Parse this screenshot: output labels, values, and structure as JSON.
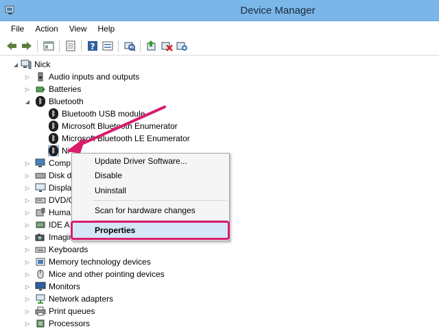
{
  "window": {
    "title": "Device Manager"
  },
  "menu": [
    "File",
    "Action",
    "View",
    "Help"
  ],
  "toolbar": {
    "buttons": [
      "back-icon",
      "forward-icon",
      "properties-pane-icon",
      "show-hide-console-tree-icon",
      "help-icon",
      "view-icon",
      "scan-icon",
      "update-driver-icon",
      "uninstall-icon",
      "add-hardware-icon"
    ]
  },
  "tree": {
    "root": "Nick",
    "items": [
      {
        "label": "Audio inputs and outputs",
        "icon": "speaker-icon"
      },
      {
        "label": "Batteries",
        "icon": "battery-icon"
      },
      {
        "label": "Bluetooth",
        "icon": "bluetooth-icon",
        "expanded": true
      },
      {
        "label": "Bluetooth USB module",
        "icon": "bluetooth-icon",
        "child": true
      },
      {
        "label": "Microsoft Bluetooth Enumerator",
        "icon": "bluetooth-icon",
        "child": true
      },
      {
        "label": "Microsoft Bluetooth LE Enumerator",
        "icon": "bluetooth-icon",
        "child": true
      },
      {
        "label": "Ni",
        "icon": "bluetooth-icon",
        "child": true,
        "selected": true
      },
      {
        "label": "Comp",
        "icon": "computer-icon"
      },
      {
        "label": "Disk d",
        "icon": "disk-icon"
      },
      {
        "label": "Displa",
        "icon": "display-icon"
      },
      {
        "label": "DVD/C",
        "icon": "dvd-icon"
      },
      {
        "label": "Huma",
        "icon": "hid-icon"
      },
      {
        "label": "IDE A",
        "icon": "ide-icon"
      },
      {
        "label": "Imagin",
        "icon": "camera-icon"
      },
      {
        "label": "Keyboards",
        "icon": "keyboard-icon"
      },
      {
        "label": "Memory technology devices",
        "icon": "memory-icon"
      },
      {
        "label": "Mice and other pointing devices",
        "icon": "mouse-icon"
      },
      {
        "label": "Monitors",
        "icon": "monitor-icon"
      },
      {
        "label": "Network adapters",
        "icon": "network-icon"
      },
      {
        "label": "Print queues",
        "icon": "printer-icon"
      },
      {
        "label": "Processors",
        "icon": "processor-icon"
      }
    ]
  },
  "context_menu": {
    "items": [
      "Update Driver Software...",
      "Disable",
      "Uninstall",
      "Scan for hardware changes",
      "Properties"
    ],
    "highlighted": "Properties",
    "highlight_color": "#d81c6b"
  },
  "colors": {
    "titlebar": "#7ab6e8",
    "annotation": "#d81c6b"
  }
}
